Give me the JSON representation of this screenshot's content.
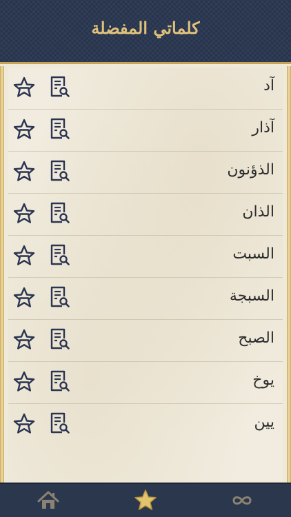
{
  "header": {
    "title": "كلماتي المفضلة"
  },
  "list": {
    "items": [
      {
        "word": "آد"
      },
      {
        "word": "آذار"
      },
      {
        "word": "الذؤنون"
      },
      {
        "word": "الذان"
      },
      {
        "word": "السبت"
      },
      {
        "word": "السبجة"
      },
      {
        "word": "الصبح"
      },
      {
        "word": "يوخ"
      },
      {
        "word": "يين"
      }
    ],
    "row_icons": [
      "star-remove-icon",
      "document-search-icon"
    ]
  },
  "tabbar": {
    "tabs": [
      {
        "icon": "home-icon"
      },
      {
        "icon": "star-icon",
        "active": true
      },
      {
        "icon": "infinity-icon"
      }
    ]
  },
  "colors": {
    "header_bg": "#27344d",
    "title_gold": "#e0c27a",
    "icon_navy": "#2b3450",
    "tab_gold": "#e3c46e"
  }
}
